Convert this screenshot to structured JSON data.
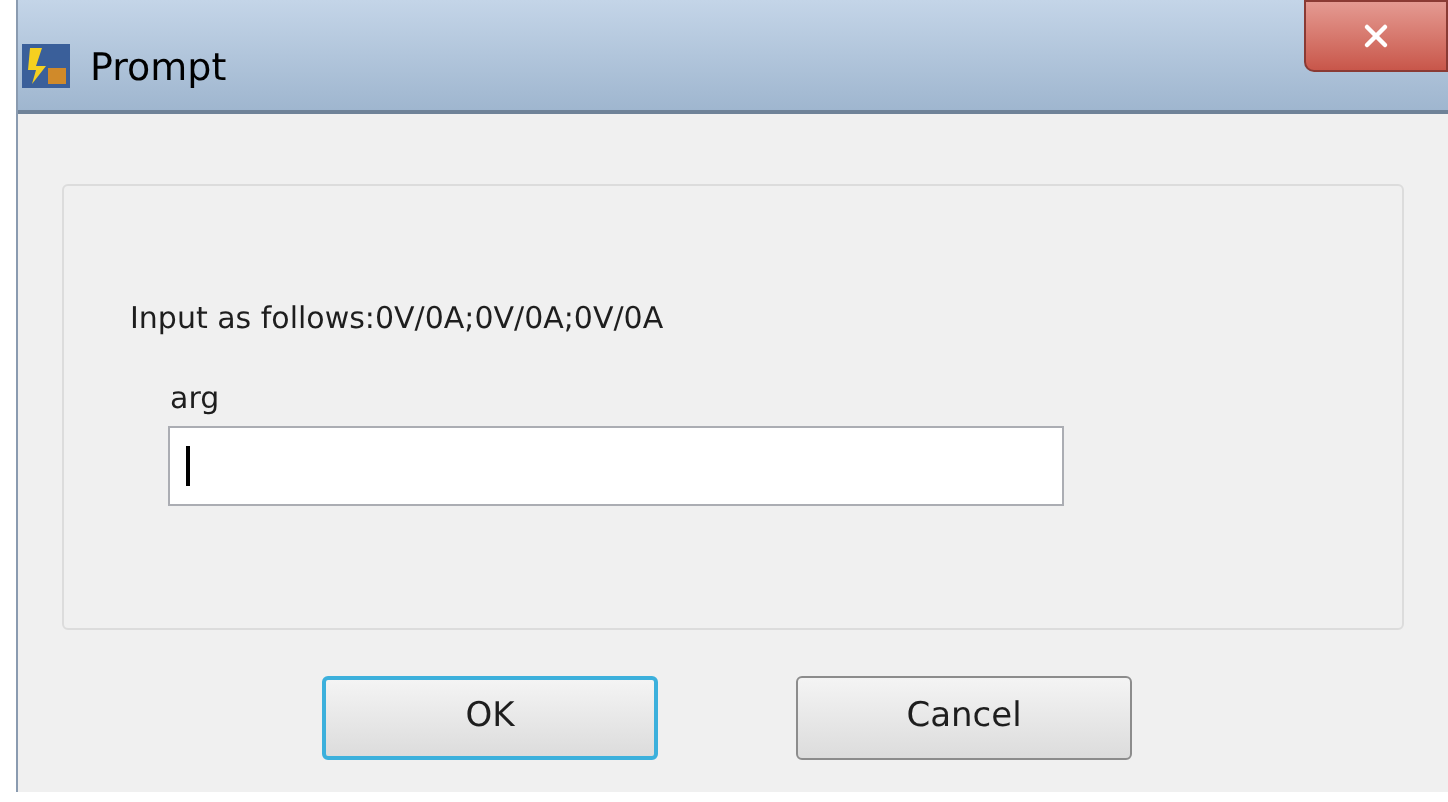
{
  "window": {
    "title": "Prompt"
  },
  "prompt": {
    "message": "Input as follows:0V/0A;0V/0A;0V/0A",
    "field_label": "arg"
  },
  "buttons": [
    {
      "label": "OK",
      "focused": true
    },
    {
      "label": "Cancel",
      "focused": false
    }
  ]
}
